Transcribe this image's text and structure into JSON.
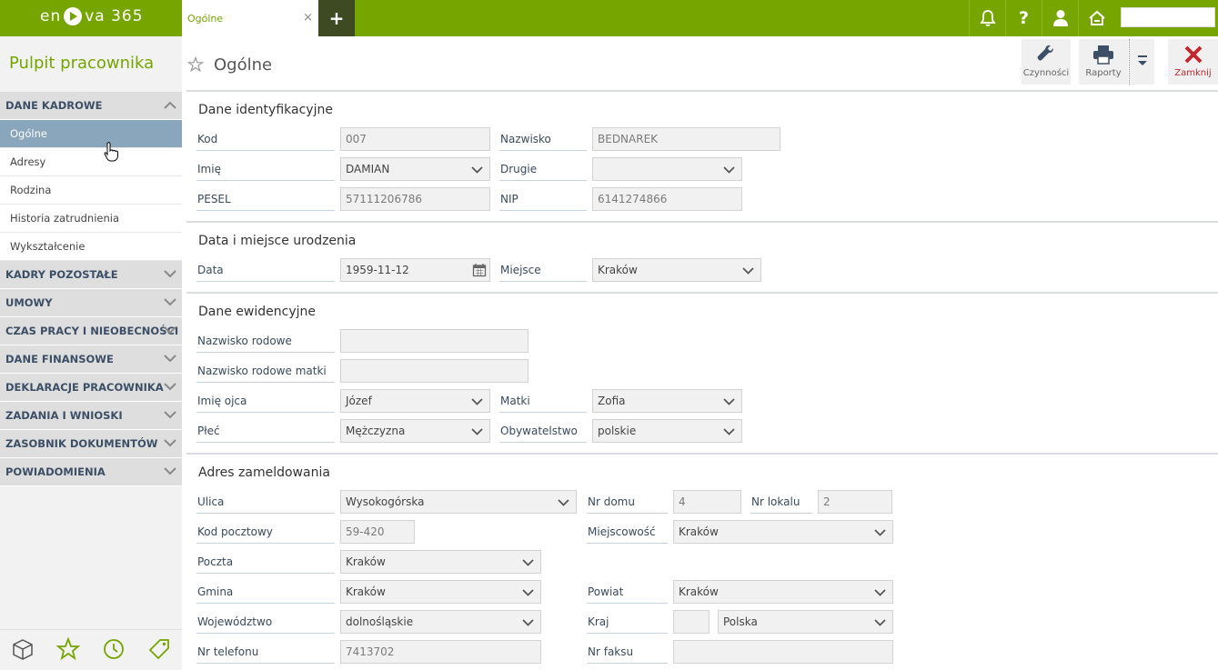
{
  "app": {
    "logo_left": "en",
    "logo_right": "va 365"
  },
  "tabs": [
    {
      "label": "Ogólne",
      "close": "×"
    }
  ],
  "tab_add": "+",
  "topbar_icons": [
    "bell-icon",
    "help-icon",
    "user-icon",
    "home-icon"
  ],
  "sidebar": {
    "title": "Pulpit pracownika",
    "sections": [
      {
        "label": "DANE KADROWE",
        "expanded": true,
        "items": [
          "Ogólne",
          "Adresy",
          "Rodzina",
          "Historia zatrudnienia",
          "Wykształcenie"
        ]
      },
      {
        "label": "KADRY POZOSTAŁE"
      },
      {
        "label": "UMOWY"
      },
      {
        "label": "CZAS PRACY I NIEOBECNOŚCI"
      },
      {
        "label": "DANE FINANSOWE"
      },
      {
        "label": "DEKLARACJE PRACOWNIKA"
      },
      {
        "label": "ZADANIA I WNIOSKI"
      },
      {
        "label": "ZASOBNIK DOKUMENTÓW"
      },
      {
        "label": "POWIADOMIENIA"
      }
    ],
    "bottom_icons": [
      "box-icon",
      "star-icon",
      "clock-icon",
      "tag-icon"
    ]
  },
  "page": {
    "title": "Ogólne"
  },
  "toolbar": {
    "czynnosci": "Czynności",
    "raporty": "Raporty",
    "zamknij": "Zamknij"
  },
  "colors": {
    "brand": "#76a500",
    "close": "#c0272d",
    "active_nav": "#8aa6bd"
  },
  "sections": {
    "ident": {
      "title": "Dane identyfikacyjne",
      "kod_label": "Kod",
      "kod": "007",
      "nazwisko_label": "Nazwisko",
      "nazwisko": "BEDNAREK",
      "imie_label": "Imię",
      "imie": "DAMIAN",
      "drugie_label": "Drugie",
      "drugie": "",
      "pesel_label": "PESEL",
      "pesel": "57111206786",
      "nip_label": "NIP",
      "nip": "6141274866"
    },
    "birth": {
      "title": "Data i miejsce urodzenia",
      "data_label": "Data",
      "data": "1959-11-12",
      "miejsce_label": "Miejsce",
      "miejsce": "Kraków"
    },
    "ewid": {
      "title": "Dane ewidencyjne",
      "nazwisko_rodowe_label": "Nazwisko rodowe",
      "nazwisko_rodowe": "",
      "nazwisko_matki_label": "Nazwisko rodowe matki",
      "nazwisko_matki": "",
      "imie_ojca_label": "Imię ojca",
      "imie_ojca": "Józef",
      "matki_label": "Matki",
      "matki": "Zofia",
      "plec_label": "Płeć",
      "plec": "Mężczyzna",
      "obywatelstwo_label": "Obywatelstwo",
      "obywatelstwo": "polskie"
    },
    "adres": {
      "title": "Adres zameldowania",
      "ulica_label": "Ulica",
      "ulica": "Wysokogórska",
      "nr_domu_label": "Nr domu",
      "nr_domu": "4",
      "nr_lokalu_label": "Nr lokalu",
      "nr_lokalu": "2",
      "kod_label": "Kod pocztowy",
      "kod": "59-420",
      "miejscowosc_label": "Miejscowość",
      "miejscowosc": "Kraków",
      "poczta_label": "Poczta",
      "poczta": "Kraków",
      "gmina_label": "Gmina",
      "gmina": "Kraków",
      "powiat_label": "Powiat",
      "powiat": "Kraków",
      "woj_label": "Województwo",
      "woj": "dolnośląskie",
      "kraj_label": "Kraj",
      "kraj_code": "",
      "kraj": "Polska",
      "tel_label": "Nr telefonu",
      "tel": "7413702",
      "faks_label": "Nr faksu",
      "faks": ""
    }
  }
}
